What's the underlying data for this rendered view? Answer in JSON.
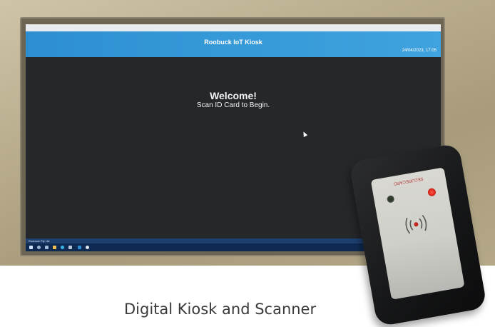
{
  "kiosk": {
    "app_title": "Roobuck IoT Kiosk",
    "datetime": "24/04/2023, 17:05",
    "welcome_title": "Welcome!",
    "welcome_subtitle": "Scan ID Card to Begin.",
    "taskbar_label": "Roobuck Pty Ltd"
  },
  "scanner": {
    "brand_label": "SECURECARD",
    "led_colors": [
      "#2e3a2c",
      "#e02a1c"
    ]
  },
  "caption": "Digital Kiosk and Scanner",
  "colors": {
    "header_blue": "#3fa3df",
    "screen_dark": "#24282b",
    "taskbar_navy": "#0f2a52"
  }
}
